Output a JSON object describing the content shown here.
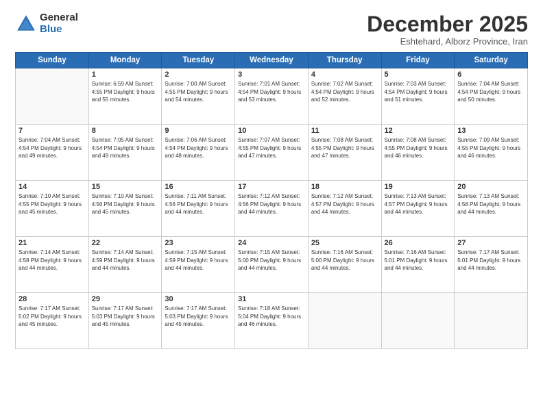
{
  "header": {
    "logo_general": "General",
    "logo_blue": "Blue",
    "month_title": "December 2025",
    "subtitle": "Eshtehard, Alborz Province, Iran"
  },
  "weekdays": [
    "Sunday",
    "Monday",
    "Tuesday",
    "Wednesday",
    "Thursday",
    "Friday",
    "Saturday"
  ],
  "weeks": [
    [
      {
        "day": "",
        "info": ""
      },
      {
        "day": "1",
        "info": "Sunrise: 6:59 AM\nSunset: 4:55 PM\nDaylight: 9 hours\nand 55 minutes."
      },
      {
        "day": "2",
        "info": "Sunrise: 7:00 AM\nSunset: 4:55 PM\nDaylight: 9 hours\nand 54 minutes."
      },
      {
        "day": "3",
        "info": "Sunrise: 7:01 AM\nSunset: 4:54 PM\nDaylight: 9 hours\nand 53 minutes."
      },
      {
        "day": "4",
        "info": "Sunrise: 7:02 AM\nSunset: 4:54 PM\nDaylight: 9 hours\nand 52 minutes."
      },
      {
        "day": "5",
        "info": "Sunrise: 7:03 AM\nSunset: 4:54 PM\nDaylight: 9 hours\nand 51 minutes."
      },
      {
        "day": "6",
        "info": "Sunrise: 7:04 AM\nSunset: 4:54 PM\nDaylight: 9 hours\nand 50 minutes."
      }
    ],
    [
      {
        "day": "7",
        "info": "Sunrise: 7:04 AM\nSunset: 4:54 PM\nDaylight: 9 hours\nand 49 minutes."
      },
      {
        "day": "8",
        "info": "Sunrise: 7:05 AM\nSunset: 4:54 PM\nDaylight: 9 hours\nand 49 minutes."
      },
      {
        "day": "9",
        "info": "Sunrise: 7:06 AM\nSunset: 4:54 PM\nDaylight: 9 hours\nand 48 minutes."
      },
      {
        "day": "10",
        "info": "Sunrise: 7:07 AM\nSunset: 4:55 PM\nDaylight: 9 hours\nand 47 minutes."
      },
      {
        "day": "11",
        "info": "Sunrise: 7:08 AM\nSunset: 4:55 PM\nDaylight: 9 hours\nand 47 minutes."
      },
      {
        "day": "12",
        "info": "Sunrise: 7:08 AM\nSunset: 4:55 PM\nDaylight: 9 hours\nand 46 minutes."
      },
      {
        "day": "13",
        "info": "Sunrise: 7:09 AM\nSunset: 4:55 PM\nDaylight: 9 hours\nand 46 minutes."
      }
    ],
    [
      {
        "day": "14",
        "info": "Sunrise: 7:10 AM\nSunset: 4:55 PM\nDaylight: 9 hours\nand 45 minutes."
      },
      {
        "day": "15",
        "info": "Sunrise: 7:10 AM\nSunset: 4:56 PM\nDaylight: 9 hours\nand 45 minutes."
      },
      {
        "day": "16",
        "info": "Sunrise: 7:11 AM\nSunset: 4:56 PM\nDaylight: 9 hours\nand 44 minutes."
      },
      {
        "day": "17",
        "info": "Sunrise: 7:12 AM\nSunset: 4:56 PM\nDaylight: 9 hours\nand 44 minutes."
      },
      {
        "day": "18",
        "info": "Sunrise: 7:12 AM\nSunset: 4:57 PM\nDaylight: 9 hours\nand 44 minutes."
      },
      {
        "day": "19",
        "info": "Sunrise: 7:13 AM\nSunset: 4:57 PM\nDaylight: 9 hours\nand 44 minutes."
      },
      {
        "day": "20",
        "info": "Sunrise: 7:13 AM\nSunset: 4:58 PM\nDaylight: 9 hours\nand 44 minutes."
      }
    ],
    [
      {
        "day": "21",
        "info": "Sunrise: 7:14 AM\nSunset: 4:58 PM\nDaylight: 9 hours\nand 44 minutes."
      },
      {
        "day": "22",
        "info": "Sunrise: 7:14 AM\nSunset: 4:59 PM\nDaylight: 9 hours\nand 44 minutes."
      },
      {
        "day": "23",
        "info": "Sunrise: 7:15 AM\nSunset: 4:59 PM\nDaylight: 9 hours\nand 44 minutes."
      },
      {
        "day": "24",
        "info": "Sunrise: 7:15 AM\nSunset: 5:00 PM\nDaylight: 9 hours\nand 44 minutes."
      },
      {
        "day": "25",
        "info": "Sunrise: 7:16 AM\nSunset: 5:00 PM\nDaylight: 9 hours\nand 44 minutes."
      },
      {
        "day": "26",
        "info": "Sunrise: 7:16 AM\nSunset: 5:01 PM\nDaylight: 9 hours\nand 44 minutes."
      },
      {
        "day": "27",
        "info": "Sunrise: 7:17 AM\nSunset: 5:01 PM\nDaylight: 9 hours\nand 44 minutes."
      }
    ],
    [
      {
        "day": "28",
        "info": "Sunrise: 7:17 AM\nSunset: 5:02 PM\nDaylight: 9 hours\nand 45 minutes."
      },
      {
        "day": "29",
        "info": "Sunrise: 7:17 AM\nSunset: 5:03 PM\nDaylight: 9 hours\nand 45 minutes."
      },
      {
        "day": "30",
        "info": "Sunrise: 7:17 AM\nSunset: 5:03 PM\nDaylight: 9 hours\nand 45 minutes."
      },
      {
        "day": "31",
        "info": "Sunrise: 7:18 AM\nSunset: 5:04 PM\nDaylight: 9 hours\nand 46 minutes."
      },
      {
        "day": "",
        "info": ""
      },
      {
        "day": "",
        "info": ""
      },
      {
        "day": "",
        "info": ""
      }
    ]
  ]
}
